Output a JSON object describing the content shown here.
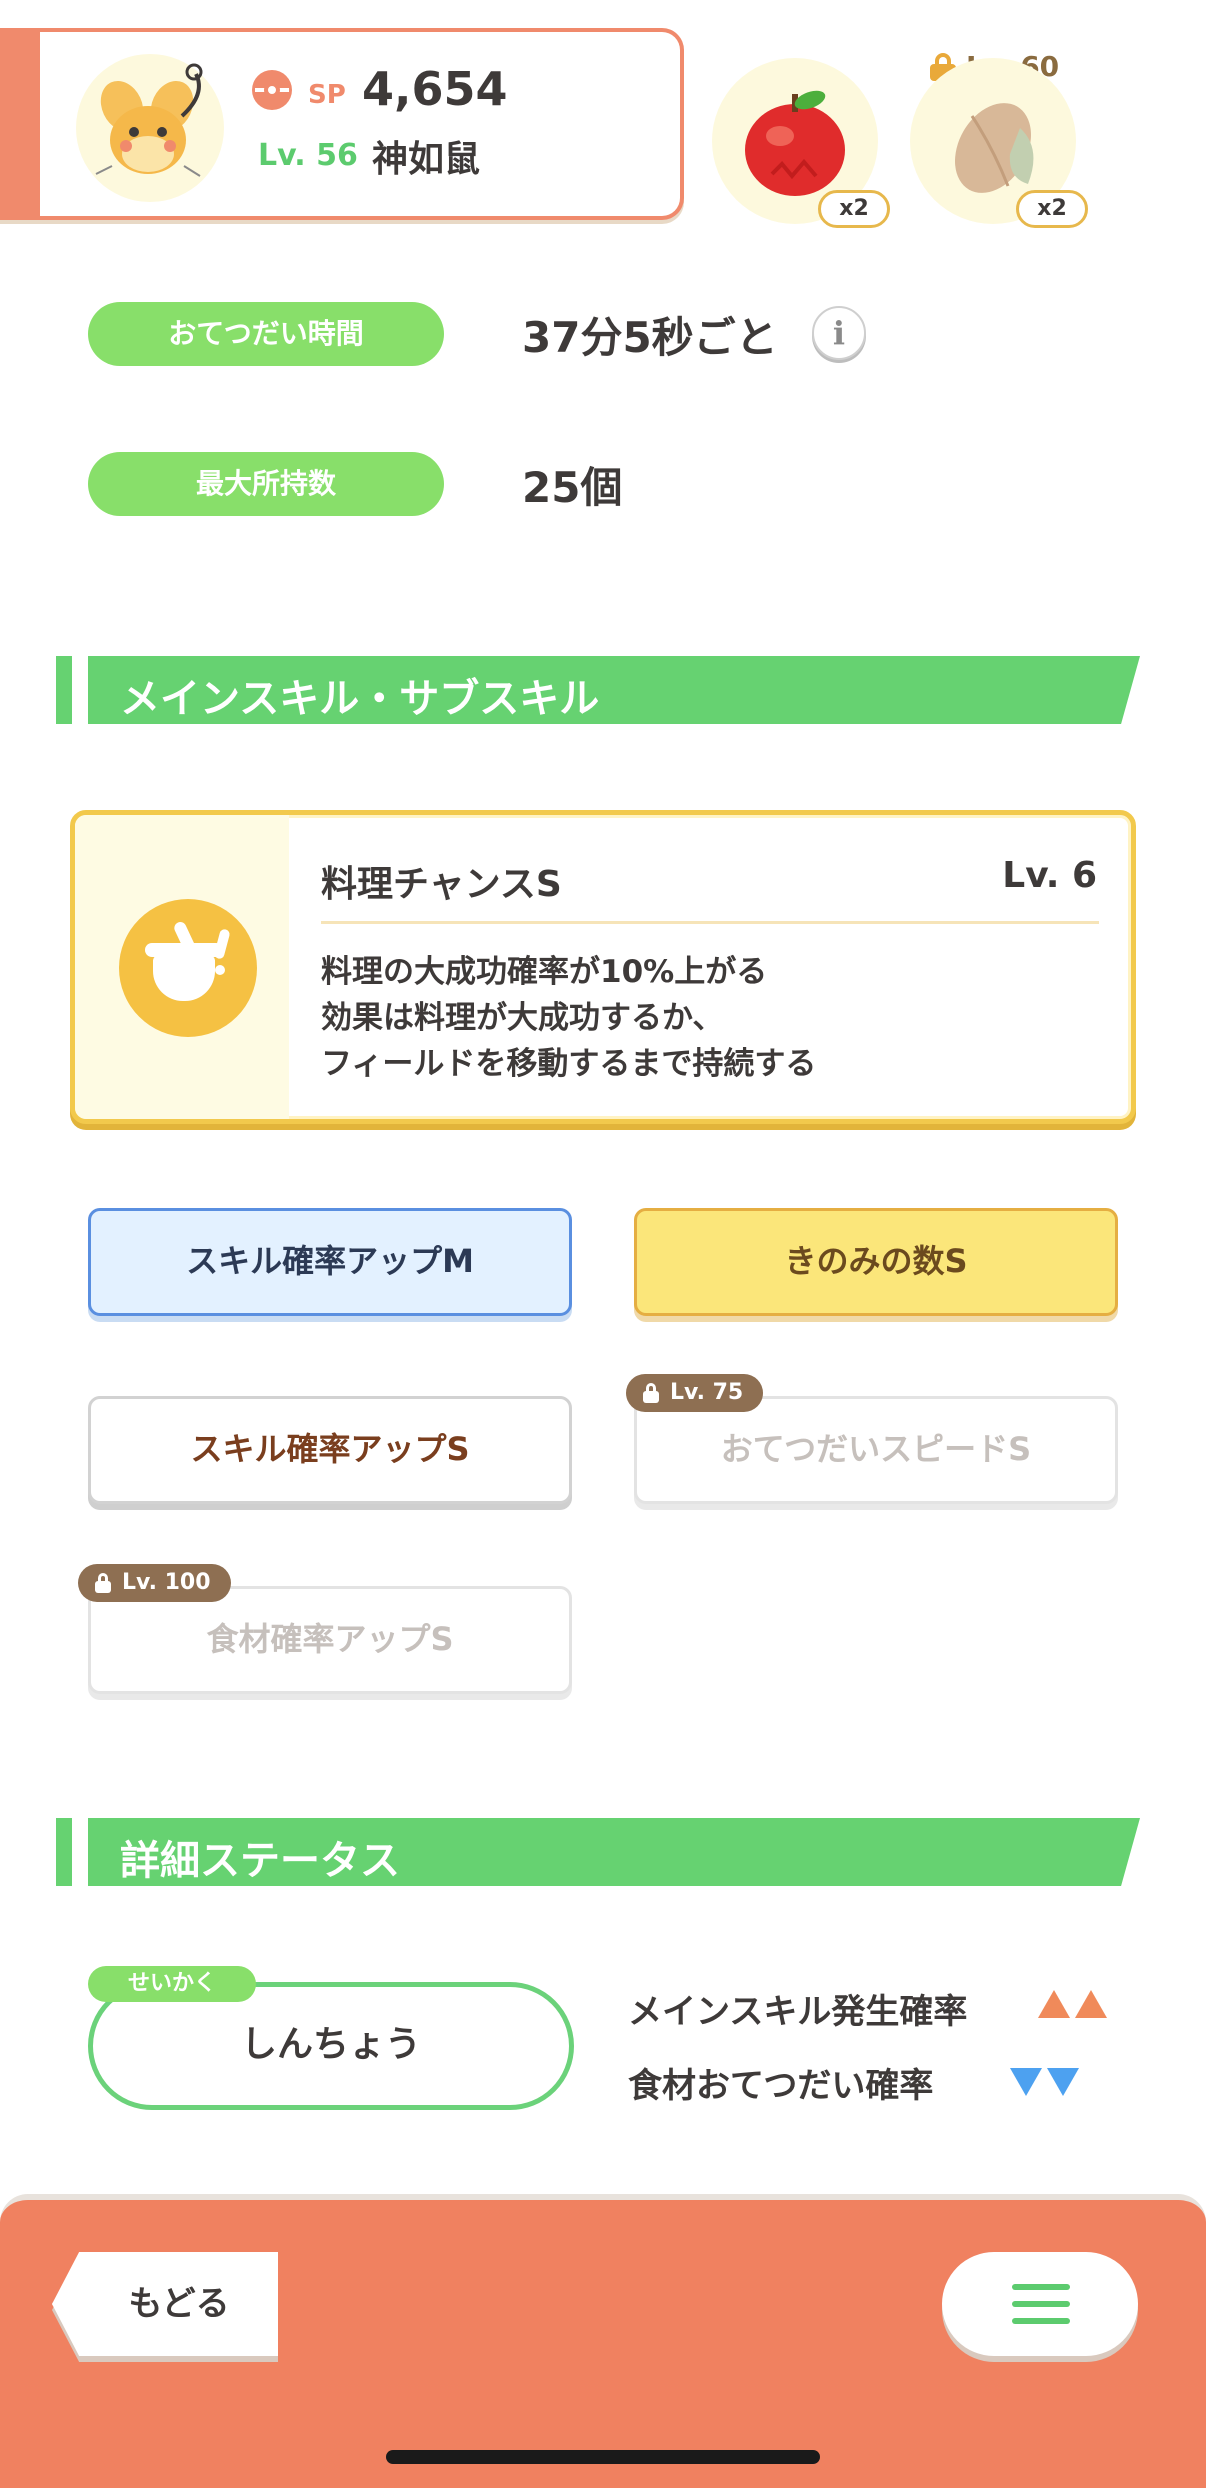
{
  "pokemon": {
    "sp_label": "SP",
    "sp_value": "4,654",
    "level_label": "Lv. 56",
    "name": "神如鼠"
  },
  "ingredients": [
    {
      "name": "apple",
      "qty": "x2"
    },
    {
      "name": "cacao",
      "qty": "x2",
      "lock_level": "Lv. 60"
    }
  ],
  "info": {
    "help_time_label": "おてつだい時間",
    "help_time_value": "37分5秒ごと",
    "info_icon": "i",
    "max_carry_label": "最大所持数",
    "max_carry_value": "25個"
  },
  "skills_section": {
    "title": "メインスキル・サブスキル"
  },
  "main_skill": {
    "name": "料理チャンスS",
    "level": "Lv. 6",
    "desc_line1": "料理の大成功確率が10%上がる",
    "desc_line2": "効果は料理が大成功するか、",
    "desc_line3": "フィールドを移動するまで持続する"
  },
  "sub_skills": [
    {
      "label": "スキル確率アップM",
      "style": "blue"
    },
    {
      "label": "きのみの数S",
      "style": "gold"
    },
    {
      "label": "スキル確率アップS",
      "style": "white"
    },
    {
      "label": "おてつだいスピードS",
      "style": "locked",
      "lock_level": "Lv. 75"
    },
    {
      "label": "食材確率アップS",
      "style": "locked",
      "lock_level": "Lv. 100"
    }
  ],
  "status_section": {
    "title": "詳細ステータス",
    "nature_tag": "せいかく",
    "nature_value": "しんちょう",
    "up_label": "メインスキル発生確率",
    "down_label": "食材おてつだい確率"
  },
  "bottom": {
    "back_label": "もどる",
    "menu_icon": "hamburger-icon"
  },
  "colors": {
    "accent_orange": "#f08160",
    "accent_green": "#66d271",
    "accent_gold": "#f2c94c",
    "up_arrow": "#f08a5a",
    "down_arrow": "#4da1f0"
  }
}
